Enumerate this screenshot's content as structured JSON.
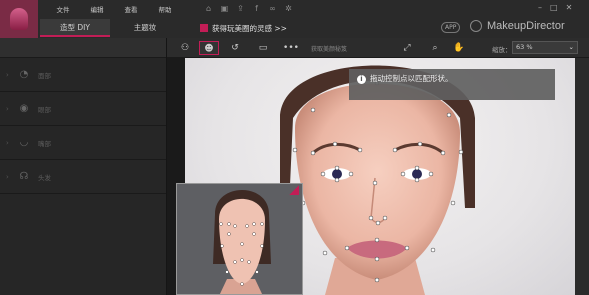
{
  "menu": [
    "文件",
    "编辑",
    "查看",
    "帮助"
  ],
  "tabs": {
    "diy": "造型 DIY",
    "theme": "主题妆"
  },
  "promo": "获得玩美圈的灵感 >>",
  "app_badge": "APP",
  "brand": "MakeupDirector",
  "sidebar": {
    "items": [
      {
        "label": "面部",
        "icon": "face-icon"
      },
      {
        "label": "眼部",
        "icon": "eye-icon"
      },
      {
        "label": "嘴部",
        "icon": "lips-icon"
      },
      {
        "label": "头发",
        "icon": "hair-icon"
      }
    ]
  },
  "toolbar": {
    "hint": "获取美颜秘笈",
    "zoom_label": "缩放：",
    "zoom_value": "63 %"
  },
  "tip": "拖动控制点以匹配形状。",
  "colors": {
    "accent": "#c21d56",
    "chrome": "#2a2a2a",
    "sidebar": "#262626"
  }
}
